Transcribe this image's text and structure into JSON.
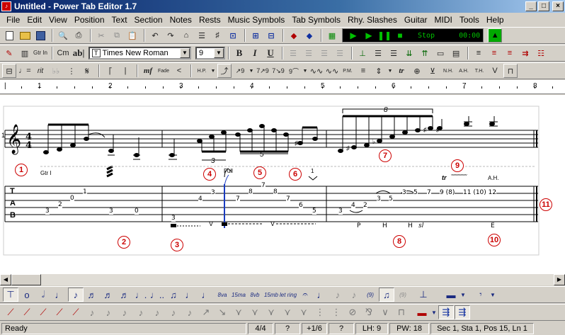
{
  "window": {
    "title": "Untitled - Power Tab Editor 1.7",
    "controls": [
      "_",
      "□",
      "×"
    ]
  },
  "menu": [
    "File",
    "Edit",
    "View",
    "Position",
    "Text",
    "Section",
    "Notes",
    "Rests",
    "Music Symbols",
    "Tab Symbols",
    "Rhy. Slashes",
    "Guitar",
    "MIDI",
    "Tools",
    "Help"
  ],
  "toolbar2": {
    "chord_label": "Cm",
    "text_label": "ab|",
    "font_name": "Times New Roman",
    "font_size": "9",
    "bold": "B",
    "italic": "I",
    "underline": "U",
    "gtr_in": "Gtr In"
  },
  "player": {
    "status": "Stop",
    "time": "00:00"
  },
  "toolbar3": {
    "rit": "rit",
    "mf": "mf",
    "fade": "Fade",
    "hp": "H.P.",
    "pm": "P.M.",
    "tr": "tr",
    "nh": "N.H.",
    "ah": "A.H.",
    "th": "T.H.",
    "v": "V"
  },
  "ruler": [
    "1",
    "2",
    "3",
    "4",
    "5",
    "6",
    "7",
    "8"
  ],
  "score": {
    "time_signature": {
      "top": "4",
      "bottom": "4"
    },
    "tab_clef": [
      "T",
      "A",
      "B"
    ],
    "gtr_label": "Gtr I",
    "tuplet_3_a": "3",
    "tuplet_5": "5",
    "tuplet_8": "8",
    "bend_label": "Full",
    "bend_num": "1/2",
    "vol_label": "1",
    "trill_label": "tr",
    "ah_label": "A.H.",
    "callouts": [
      "1",
      "2",
      "3",
      "4",
      "5",
      "6",
      "7",
      "8",
      "9",
      "10",
      "11"
    ],
    "tab_numbers": {
      "m1": [
        "3",
        "2",
        "0",
        "1",
        "3",
        "0"
      ],
      "m2": [
        "3",
        "4",
        "3",
        "7",
        "8",
        "7",
        "8",
        "7",
        "6",
        "5"
      ],
      "m3": [
        "3",
        "4",
        "2",
        "3",
        "5",
        "3",
        "5",
        "7",
        "9 (8)",
        "11 (10) 12"
      ]
    },
    "techniques": {
      "p": "P",
      "h1": "H",
      "h2": "H",
      "sl": "sl",
      "e": "E"
    }
  },
  "palette1": [
    "𝄼",
    "o",
    "♩",
    "♩",
    "♪",
    "♪",
    "♬",
    "♬",
    "♩.",
    "♩..",
    "♫",
    "♩",
    "♩",
    "8va",
    "15ma",
    "8vb",
    "15mb",
    "let ring",
    "𝄐",
    "♩",
    "♪",
    "♪",
    "(9)",
    "𝄞",
    "(9)"
  ],
  "palette2": [],
  "status": {
    "ready": "Ready",
    "time_sig": "4/4",
    "q1": "?",
    "fraction": "+1/6",
    "q2": "?",
    "lh": "LH: 9",
    "pw": "PW: 18",
    "position": "Sec 1, Sta 1, Pos 15, Ln 1"
  },
  "colors": {
    "title_start": "#0a246a",
    "title_end": "#a6caf0",
    "callout": "#cc0000",
    "bend": "#1a3cc0"
  }
}
